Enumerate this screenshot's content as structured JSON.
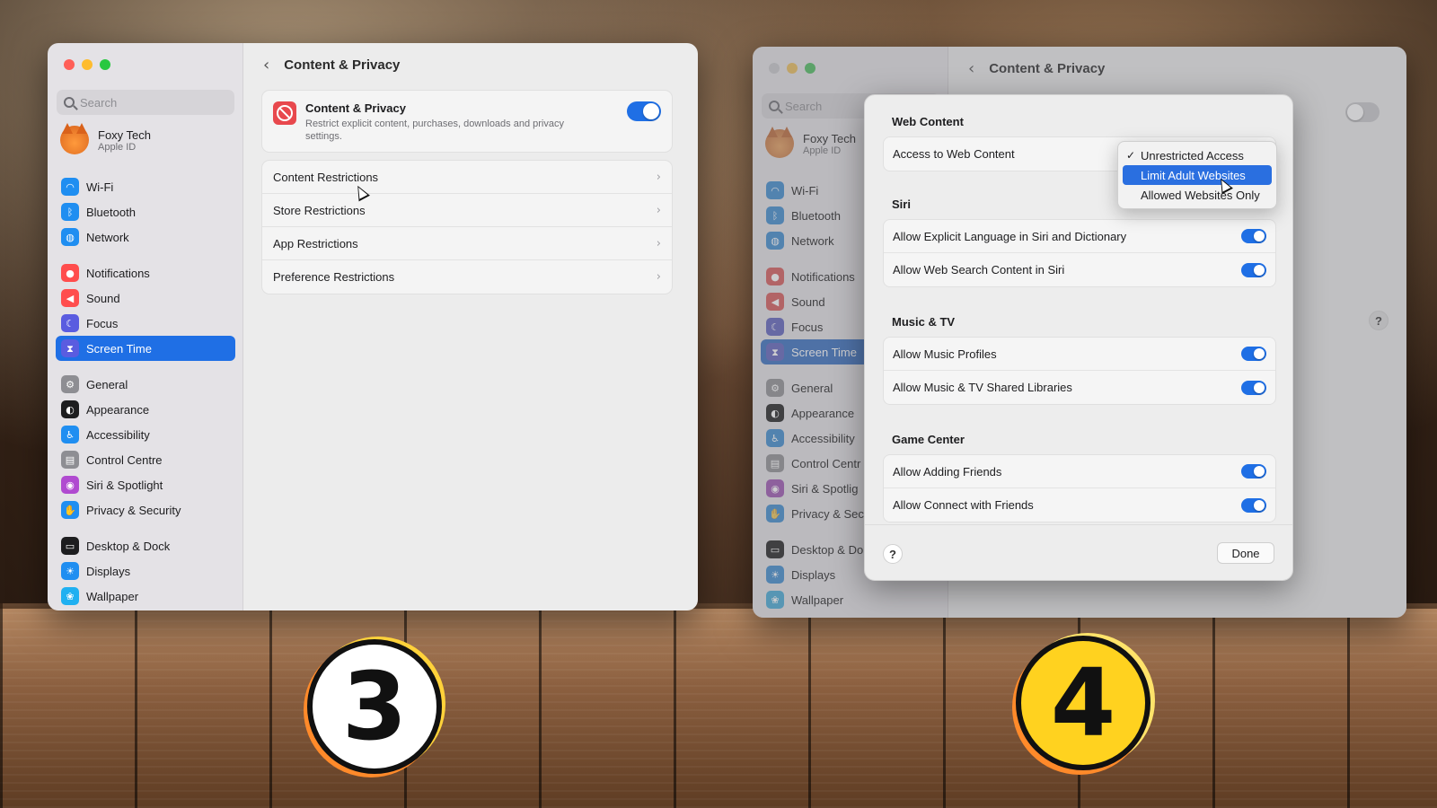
{
  "sidebar": {
    "search_placeholder": "Search",
    "user_name": "Foxy Tech",
    "user_sub": "Apple ID",
    "items": [
      {
        "label": "Wi-Fi",
        "icon": "wifi-icon",
        "color": "#1f8ef1"
      },
      {
        "label": "Bluetooth",
        "icon": "bluetooth-icon",
        "color": "#1f8ef1"
      },
      {
        "label": "Network",
        "icon": "globe-icon",
        "color": "#1f8ef1"
      },
      {
        "label": "Notifications",
        "icon": "bell-icon",
        "color": "#ff4d4d"
      },
      {
        "label": "Sound",
        "icon": "speaker-icon",
        "color": "#ff4d4d"
      },
      {
        "label": "Focus",
        "icon": "moon-icon",
        "color": "#5a5ce0"
      },
      {
        "label": "Screen Time",
        "icon": "hourglass-icon",
        "color": "#5a5ce0"
      },
      {
        "label": "General",
        "icon": "gear-icon",
        "color": "#8e8e93"
      },
      {
        "label": "Appearance",
        "icon": "appearance-icon",
        "color": "#1d1d1f"
      },
      {
        "label": "Accessibility",
        "icon": "accessibility-icon",
        "color": "#1f8ef1"
      },
      {
        "label": "Control Centre",
        "icon": "control-centre-icon",
        "color": "#8e8e93"
      },
      {
        "label": "Siri & Spotlight",
        "icon": "siri-icon",
        "color": "#b04ad0"
      },
      {
        "label": "Privacy & Security",
        "icon": "hand-icon",
        "color": "#1f8ef1"
      },
      {
        "label": "Desktop & Dock",
        "icon": "dock-icon",
        "color": "#1d1d1f"
      },
      {
        "label": "Displays",
        "icon": "sun-icon",
        "color": "#1f8ef1"
      },
      {
        "label": "Wallpaper",
        "icon": "wallpaper-icon",
        "color": "#1fb0f1"
      }
    ],
    "selected": "Screen Time"
  },
  "window3": {
    "title": "Content & Privacy",
    "header_card": {
      "name": "Content & Privacy",
      "description": "Restrict explicit content, purchases, downloads and privacy settings.",
      "enabled": true
    },
    "rows": [
      "Content Restrictions",
      "Store Restrictions",
      "App Restrictions",
      "Preference Restrictions"
    ],
    "help": "?"
  },
  "window4": {
    "title": "Content & Privacy",
    "sidebar_items": [
      "Wi-Fi",
      "Bluetooth",
      "Network",
      "Notifications",
      "Sound",
      "Focus",
      "Screen Time",
      "General",
      "Appearance",
      "Accessibility",
      "Control Centr",
      "Siri & Spotlig",
      "Privacy & Sec",
      "Desktop & Do",
      "Displays",
      "Wallpaper"
    ],
    "user_name": "Foxy Tech",
    "user_sub": "Apple ID",
    "search_placeholder": "Search",
    "help": "?"
  },
  "sheet": {
    "web_content": {
      "title": "Web Content",
      "row_label": "Access to Web Content"
    },
    "dropdown": {
      "options": [
        "Unrestricted Access",
        "Limit Adult Websites",
        "Allowed Websites Only"
      ],
      "checked": "Unrestricted Access",
      "highlighted": "Limit Adult Websites",
      "check_glyph": "✓"
    },
    "siri": {
      "title": "Siri",
      "rows": [
        {
          "label": "Allow Explicit Language in Siri and Dictionary",
          "on": true
        },
        {
          "label": "Allow Web Search Content in Siri",
          "on": true
        }
      ]
    },
    "music_tv": {
      "title": "Music & TV",
      "rows": [
        {
          "label": "Allow Music Profiles",
          "on": true
        },
        {
          "label": "Allow Music & TV Shared Libraries",
          "on": true
        }
      ]
    },
    "game_center": {
      "title": "Game Center",
      "rows": [
        {
          "label": "Allow Adding Friends",
          "on": true
        },
        {
          "label": "Allow Connect with Friends",
          "on": true
        }
      ]
    },
    "help": "?",
    "done_label": "Done"
  },
  "badges": {
    "three": "3",
    "four": "4"
  },
  "colors": {
    "accent": "#1f6fe5",
    "toggle_on": "#1f6fe5"
  }
}
